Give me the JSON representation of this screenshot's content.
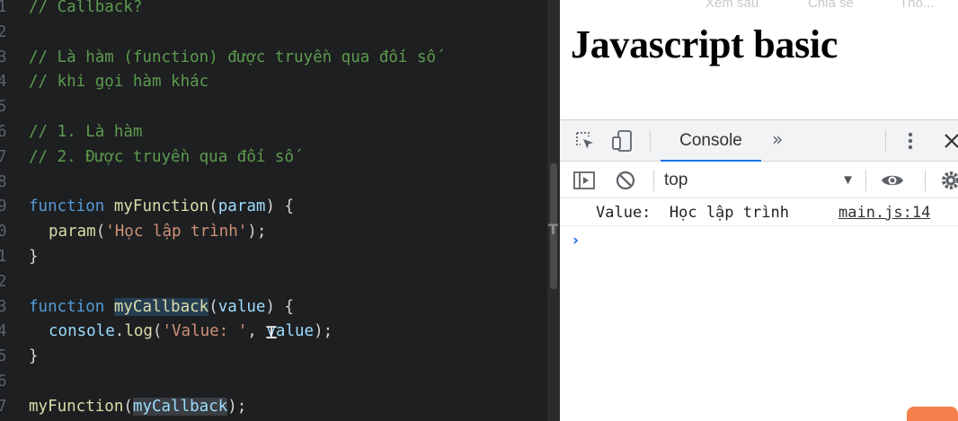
{
  "editor": {
    "lines": [
      {
        "num": "1",
        "indent": false,
        "tokens": [
          {
            "t": "// Callback?",
            "c": "cm"
          }
        ]
      },
      {
        "num": "2",
        "indent": false,
        "tokens": []
      },
      {
        "num": "3",
        "indent": false,
        "tokens": [
          {
            "t": "// Là hàm (function) được truyền qua đối số",
            "c": "cm"
          }
        ]
      },
      {
        "num": "4",
        "indent": false,
        "tokens": [
          {
            "t": "// khi gọi hàm khác",
            "c": "cm"
          }
        ]
      },
      {
        "num": "5",
        "indent": false,
        "tokens": []
      },
      {
        "num": "6",
        "indent": false,
        "tokens": [
          {
            "t": "// 1. Là hàm",
            "c": "cm"
          }
        ]
      },
      {
        "num": "7",
        "indent": false,
        "tokens": [
          {
            "t": "// 2. Được truyền qua đối số",
            "c": "cm"
          }
        ]
      },
      {
        "num": "8",
        "indent": false,
        "tokens": []
      },
      {
        "num": "9",
        "indent": false,
        "tokens": [
          {
            "t": "function",
            "c": "kw"
          },
          {
            "t": " ",
            "c": "pl"
          },
          {
            "t": "myFunction",
            "c": "fn"
          },
          {
            "t": "(",
            "c": "pl"
          },
          {
            "t": "param",
            "c": "pr"
          },
          {
            "t": ") {",
            "c": "pl"
          }
        ]
      },
      {
        "num": "0",
        "indent": true,
        "tokens": [
          {
            "t": "param",
            "c": "fn"
          },
          {
            "t": "(",
            "c": "pl"
          },
          {
            "t": "'Học lập trình'",
            "c": "st"
          },
          {
            "t": ");",
            "c": "pl"
          }
        ]
      },
      {
        "num": "1",
        "indent": false,
        "tokens": [
          {
            "t": "}",
            "c": "pl"
          }
        ]
      },
      {
        "num": "2",
        "indent": false,
        "tokens": []
      },
      {
        "num": "3",
        "indent": false,
        "tokens": [
          {
            "t": "function",
            "c": "kw"
          },
          {
            "t": " ",
            "c": "pl"
          },
          {
            "t": "myCallback",
            "c": "fn hl"
          },
          {
            "t": "(",
            "c": "pl"
          },
          {
            "t": "value",
            "c": "pr"
          },
          {
            "t": ") {",
            "c": "pl"
          }
        ]
      },
      {
        "num": "4",
        "indent": true,
        "tokens": [
          {
            "t": "console",
            "c": "pr"
          },
          {
            "t": ".",
            "c": "pl"
          },
          {
            "t": "log",
            "c": "fn"
          },
          {
            "t": "(",
            "c": "pl"
          },
          {
            "t": "'Value: '",
            "c": "st"
          },
          {
            "t": ", ",
            "c": "pl"
          },
          {
            "t": "value",
            "c": "pr"
          },
          {
            "t": ");",
            "c": "pl"
          }
        ]
      },
      {
        "num": "5",
        "indent": false,
        "tokens": [
          {
            "t": "}",
            "c": "pl"
          }
        ]
      },
      {
        "num": "6",
        "indent": false,
        "tokens": []
      },
      {
        "num": "7",
        "indent": false,
        "tokens": [
          {
            "t": "myFunction",
            "c": "fn"
          },
          {
            "t": "(",
            "c": "pl"
          },
          {
            "t": "myCallback",
            "c": "pr hl2"
          },
          {
            "t": ");",
            "c": "pl"
          }
        ]
      }
    ],
    "overlay_letter": "T"
  },
  "browser": {
    "top_links": [
      "Xem sau",
      "Chia sẻ",
      "Thô..."
    ],
    "page_heading": "Javascript basic",
    "devtools": {
      "tabs": {
        "console_label": "Console",
        "more_label": "»"
      },
      "icons": {
        "inspect": "inspect-element-icon",
        "device": "device-toolbar-icon",
        "kebab": "kebab-menu-icon",
        "close": "close-icon",
        "sidebar": "sidebar-toggle-icon",
        "clear": "clear-console-icon",
        "eye": "live-expression-eye-icon",
        "settings": "settings-gear-icon"
      },
      "context_value": "top",
      "log": {
        "message": "Value:  Học lập trình",
        "source": "main.js:14"
      },
      "prompt": "›"
    }
  },
  "colors": {
    "editor_bg": "#1e1f21",
    "comment": "#5c9b4e",
    "keyword": "#569cd6",
    "function_name": "#dcdcaa",
    "string": "#ce9178",
    "accent": "#1a73e8",
    "orange_button": "#f47f4a"
  }
}
